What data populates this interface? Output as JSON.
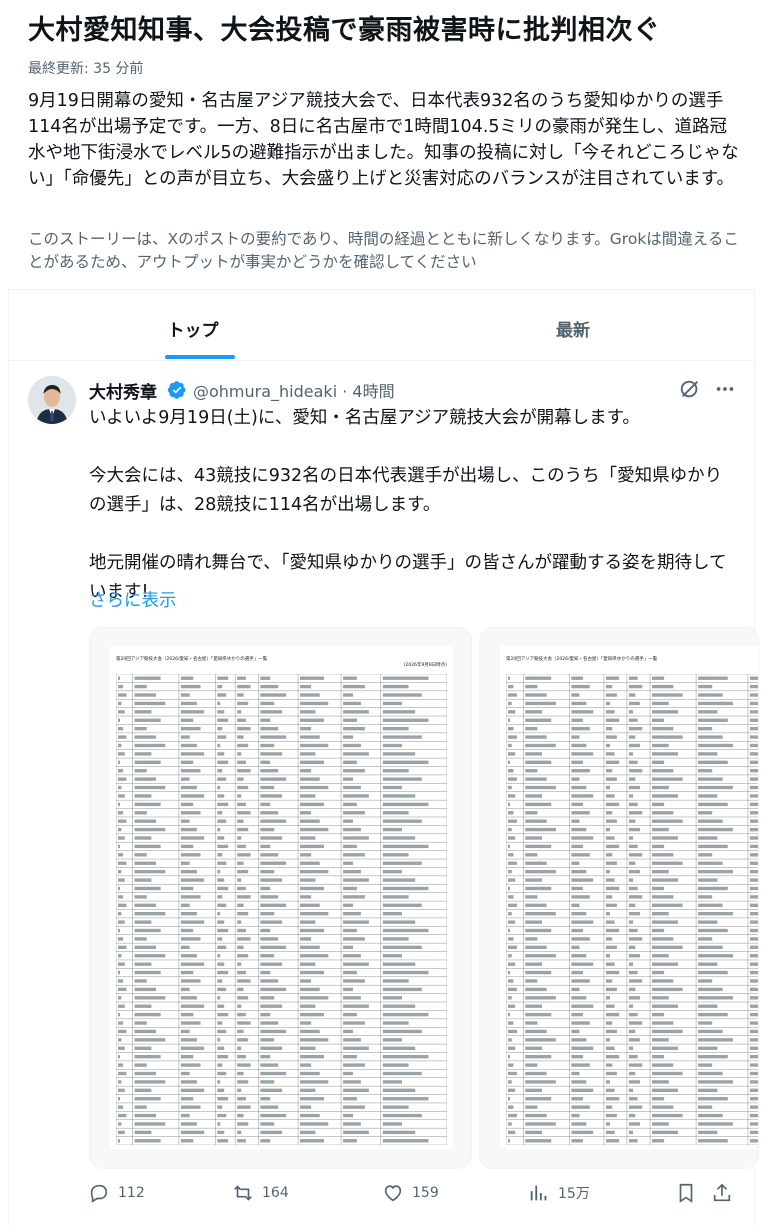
{
  "story": {
    "headline": "大村愛知知事、大会投稿で豪雨被害時に批判相次ぐ",
    "updated": "最終更新: 35 分前",
    "summary": "9月19日開幕の愛知・名古屋アジア競技大会で、日本代表932名のうち愛知ゆかりの選手114名が出場予定です。一方、8日に名古屋市で1時間104.5ミリの豪雨が発生し、道路冠水や地下街浸水でレベル5の避難指示が出ました。知事の投稿に対し「今それどころじゃない」「命優先」との声が目立ち、大会盛り上げと災害対応のバランスが注目されています。",
    "disclaimer": "このストーリーは、Xのポストの要約であり、時間の経過とともに新しくなります。Grokは間違えることがあるため、アウトプットが事実かどうかを確認してください"
  },
  "tabs": [
    {
      "label": "トップ",
      "active": true
    },
    {
      "label": "最新",
      "active": false
    }
  ],
  "post": {
    "author": "大村秀章",
    "handle": "@ohmura_hideaki · 4時間",
    "paragraphs": [
      "いよいよ9月19日(土)に、愛知・名古屋アジア競技大会が開幕します。",
      "今大会には、43競技に932名の日本代表選手が出場し、このうち「愛知県ゆかりの選手」は、28競技に114名が出場します。",
      "地元開催の晴れ舞台で、「愛知県ゆかりの選手」の皆さんが躍動する姿を期待しています!"
    ],
    "show_more": "さらに表示",
    "media": [
      {
        "title": "第20回アジア競技大会（2026/愛知・名古屋）「愛知県ゆかりの選手」一覧",
        "date": "(2026年9月8日時点)"
      },
      {
        "title": "第20回アジア競技大会（2026/愛知・名古屋）「愛知県ゆかりの選手」一覧",
        "date": ""
      }
    ],
    "icons": {
      "verified": "verified-badge-icon",
      "grok": "grok-icon",
      "more": "more-icon"
    },
    "accent_color": "#1d9bf0"
  },
  "actions": {
    "replies": "112",
    "reposts": "164",
    "likes": "159",
    "views": "15万"
  }
}
